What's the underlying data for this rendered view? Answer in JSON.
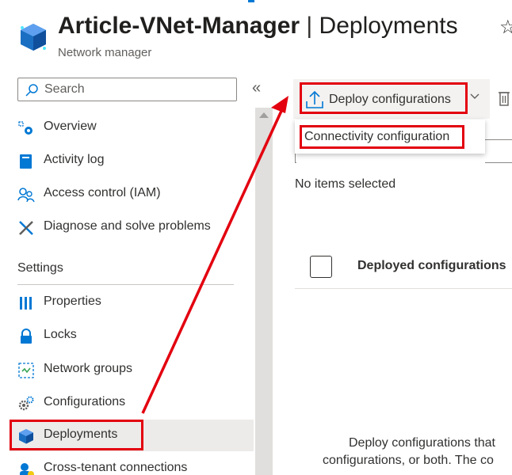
{
  "header": {
    "title_bold": "Article-VNet-Manager",
    "title_sep": " | ",
    "title_rest": "Deployments",
    "subtitle": "Network manager",
    "favorite_icon": "star-icon",
    "resource_icon": "network-manager-cube-icon"
  },
  "search": {
    "placeholder": "Search",
    "icon": "search-icon"
  },
  "sidebar": {
    "collapse_glyph": "«",
    "items": [
      {
        "label": "Overview",
        "icon": "overview-icon"
      },
      {
        "label": "Activity log",
        "icon": "activity-log-icon"
      },
      {
        "label": "Access control (IAM)",
        "icon": "access-control-icon"
      },
      {
        "label": "Diagnose and solve problems",
        "icon": "wrench-icon"
      }
    ],
    "settings_header": "Settings",
    "settings_items": [
      {
        "label": "Properties",
        "icon": "properties-icon"
      },
      {
        "label": "Locks",
        "icon": "lock-icon"
      },
      {
        "label": "Network groups",
        "icon": "network-groups-icon"
      },
      {
        "label": "Configurations",
        "icon": "configurations-icon"
      },
      {
        "label": "Deployments",
        "icon": "deployments-icon",
        "selected": true
      },
      {
        "label": "Cross-tenant connections",
        "icon": "cross-tenant-icon"
      }
    ]
  },
  "toolbar": {
    "deploy_label": "Deploy configurations",
    "deploy_icon": "upload-icon",
    "dropdown_icon": "chevron-down-icon",
    "delete_icon": "trash-icon"
  },
  "dropdown_menu": {
    "items": [
      "Connectivity configuration"
    ]
  },
  "main": {
    "selection_status": "No items selected",
    "column_header": "Deployed configurations",
    "empty_line1": "Deploy configurations that",
    "empty_line2": "configurations, or both. The co"
  },
  "colors": {
    "highlight_red": "#e3000f",
    "azure_blue": "#0078d4",
    "selected_bg": "#edebe9"
  }
}
